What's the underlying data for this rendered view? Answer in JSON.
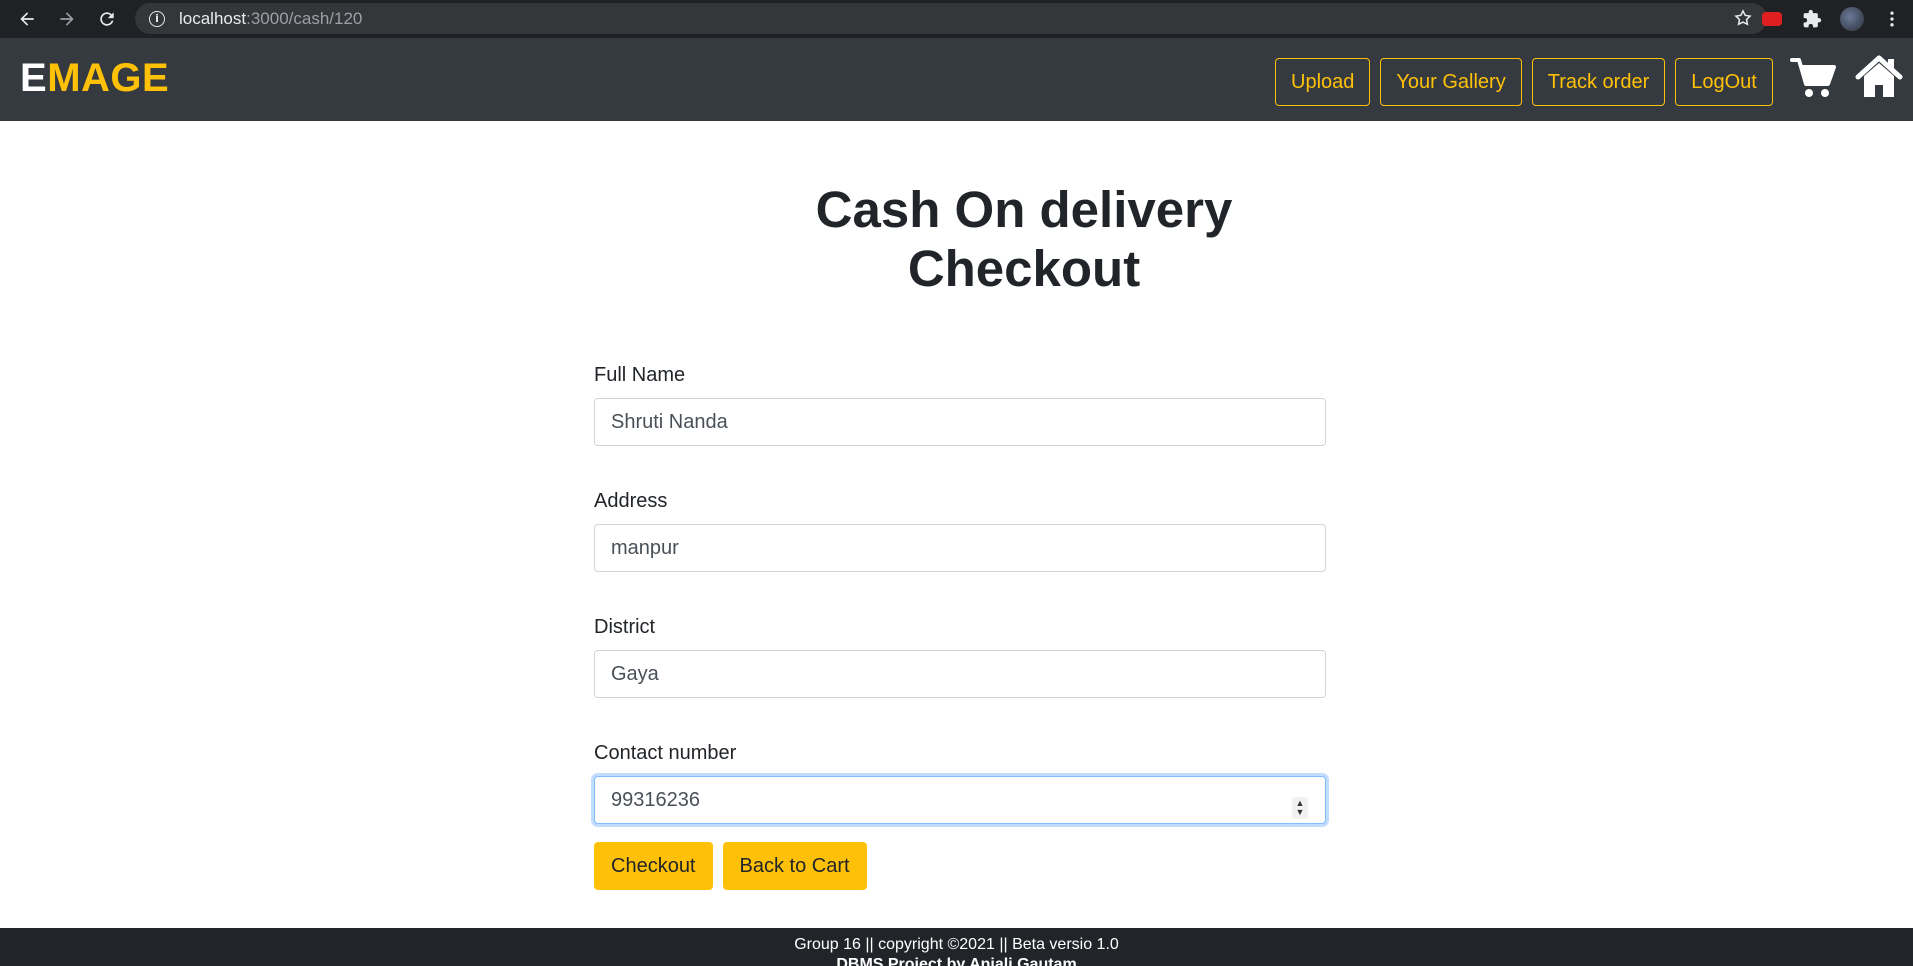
{
  "browser": {
    "url_host": "localhost",
    "url_path": ":3000/cash/120"
  },
  "navbar": {
    "brand_first": "E",
    "brand_rest": "MAGE",
    "links": [
      "Upload",
      "Your Gallery",
      "Track order",
      "LogOut"
    ],
    "icons": [
      "cart-icon",
      "home-icon"
    ],
    "accent_color": "#ffc107",
    "background_color": "#343a40"
  },
  "page": {
    "title_line1": "Cash On delivery",
    "title_line2": "Checkout"
  },
  "form": {
    "fields": [
      {
        "label": "Full Name",
        "value": "Shruti Nanda"
      },
      {
        "label": "Address",
        "value": "manpur"
      },
      {
        "label": "District",
        "value": "Gaya"
      },
      {
        "label": "Contact number",
        "value": "99316236"
      }
    ],
    "checkout_label": "Checkout",
    "back_label": "Back to Cart"
  },
  "footer": {
    "line1": "Group 16 || copyright ©2021 || Beta versio 1.0",
    "line2": "DBMS Project by Anjali Gautam"
  }
}
